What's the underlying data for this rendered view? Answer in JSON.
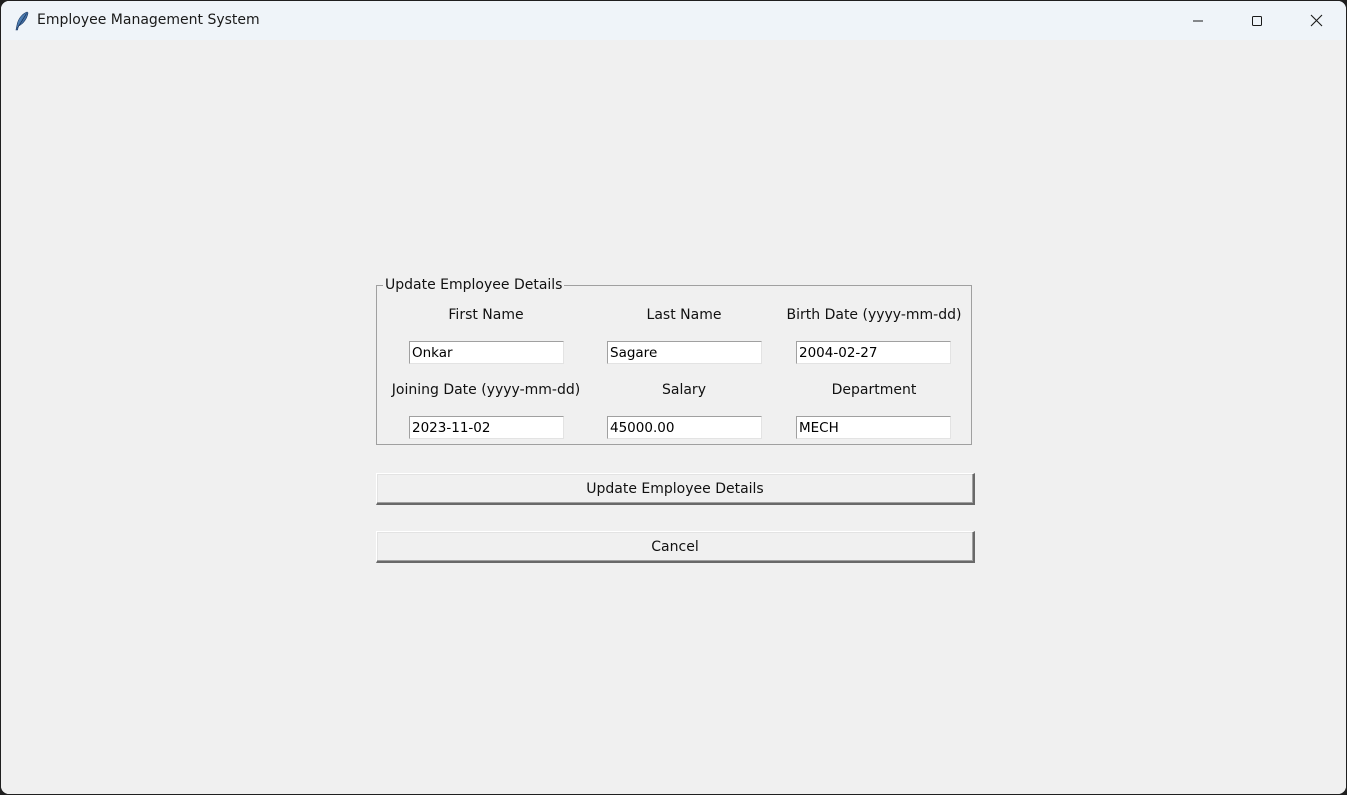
{
  "window": {
    "title": "Employee Management System",
    "app_icon": "feather-icon",
    "controls": {
      "minimize": "minimize-icon",
      "maximize": "maximize-icon",
      "close": "close-icon"
    }
  },
  "form": {
    "frame_title": "Update Employee Details",
    "fields": [
      {
        "label": "First Name",
        "value": "Onkar"
      },
      {
        "label": "Last Name",
        "value": "Sagare"
      },
      {
        "label": "Birth Date (yyyy-mm-dd)",
        "value": "2004-02-27"
      },
      {
        "label": "Joining Date (yyyy-mm-dd)",
        "value": "2023-11-02"
      },
      {
        "label": "Salary",
        "value": "45000.00"
      },
      {
        "label": "Department",
        "value": "MECH"
      }
    ]
  },
  "buttons": {
    "update_label": "Update Employee Details",
    "cancel_label": "Cancel"
  }
}
